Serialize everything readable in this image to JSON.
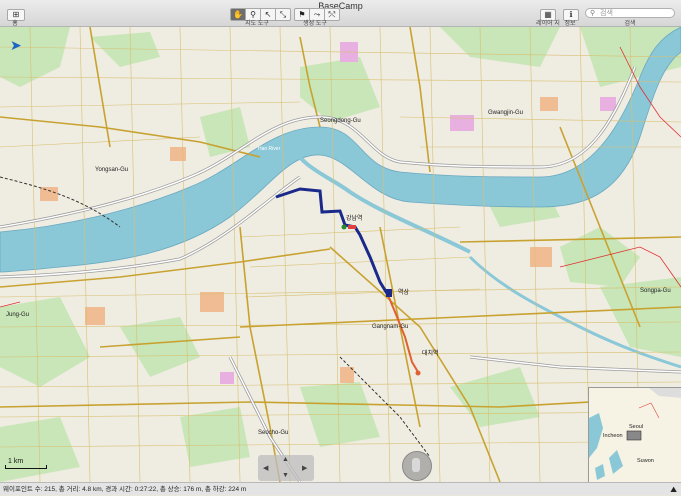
{
  "window": {
    "title": "BaseCamp"
  },
  "toolbar": {
    "left_label": "홈",
    "tools_label": "지도 도구",
    "create_label": "생성 도구",
    "layers_label": "레이어 지도",
    "info_label": "정보",
    "search_label": "검색",
    "search_placeholder": "검색"
  },
  "map_labels": {
    "river1": "Han River",
    "yongsan": "Yongsan-Gu",
    "gwangjin": "Gwangjin-Gu",
    "seongdong": "Seongdong-Gu",
    "songpa": "Songpa-Gu",
    "seocho": "Seocho-Gu",
    "jung": "Jung-Gu",
    "gangnam": "Gangnam-Gu",
    "seoul": "Seoul",
    "incheon": "Incheon",
    "suwon": "Suwon",
    "pin1": "강남역",
    "pin2": "대치역",
    "pin3": "역삼"
  },
  "scale": {
    "label": "1 km"
  },
  "status": {
    "text": "웨이포인트 수: 215, 총 거리: 4.8 km, 경과 시간: 0:27:22, 총 상승: 176 m, 총 하강: 224 m"
  },
  "colors": {
    "water": "#8ac8d8",
    "road": "#c8a230",
    "track": "#1b2a8a",
    "track_red": "#e06030",
    "park": "#c8e6b8"
  }
}
